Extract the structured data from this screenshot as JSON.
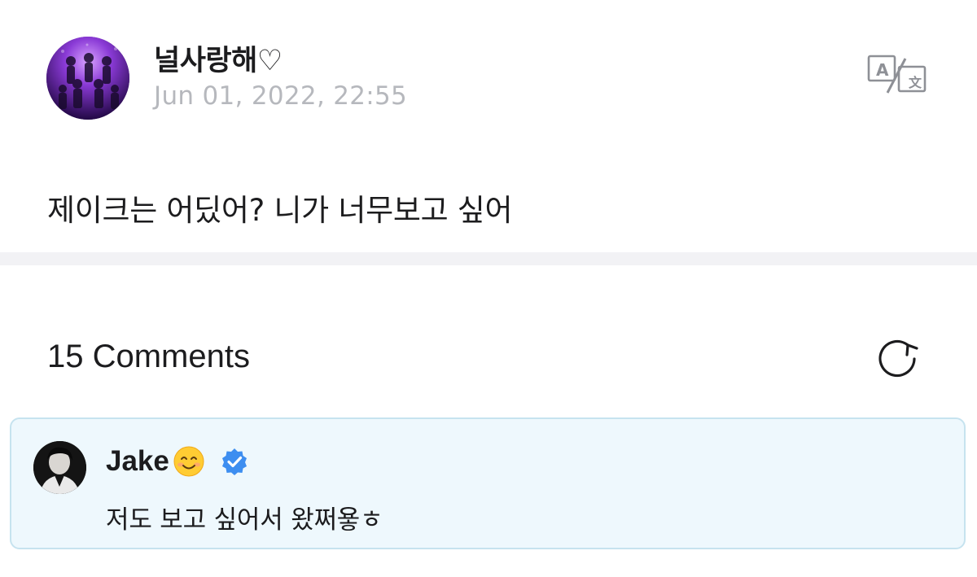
{
  "post": {
    "author": "널사랑해♡",
    "date": "Jun 01, 2022, 22:55",
    "body": "제이크는 어딨어? 니가 너무보고 싶어"
  },
  "comments": {
    "title": "15 Comments",
    "items": [
      {
        "author": "Jake",
        "verified": true,
        "text": "저도 보고 싶어서 왔쩌욯ㅎ"
      }
    ]
  },
  "icons": {
    "translate": "translate-icon",
    "refresh": "refresh-icon",
    "verified": "verified-badge-icon",
    "emoji": "smiling-face-emoji"
  },
  "colors": {
    "date_text": "#b6b8bd",
    "comment_bg": "#eef8fd",
    "comment_border": "#c6e3ef",
    "verified_blue": "#3d8ef0",
    "divider": "#f2f2f5"
  }
}
